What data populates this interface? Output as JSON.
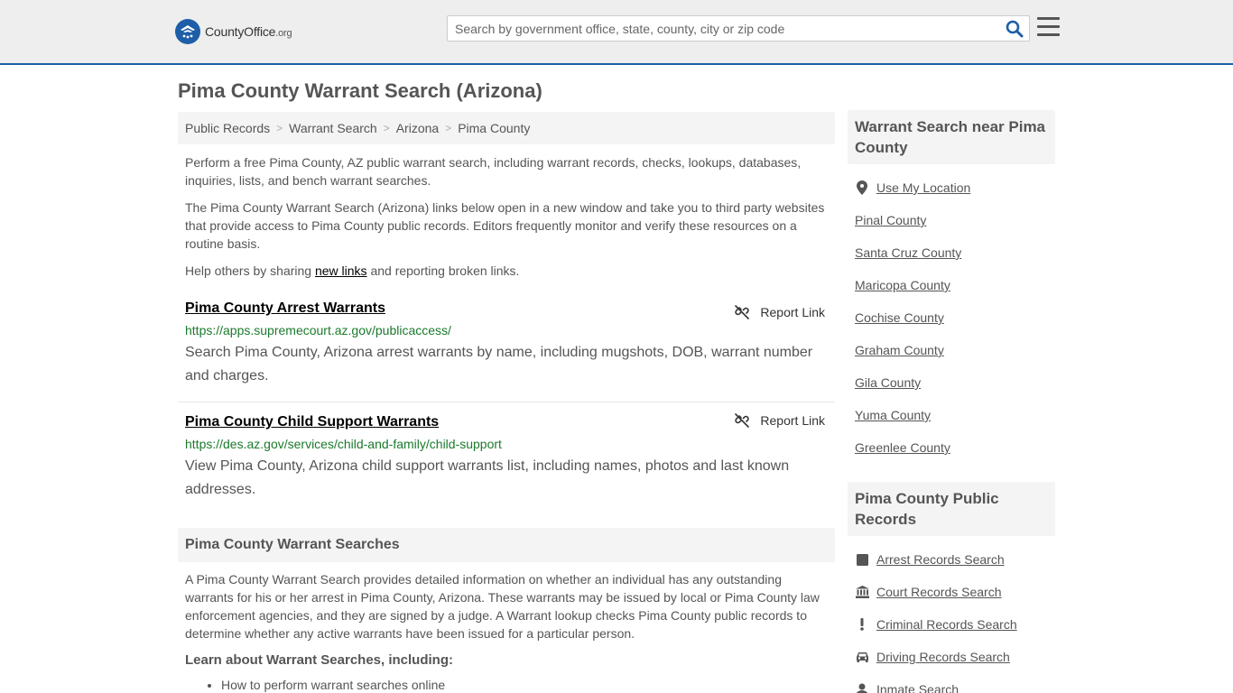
{
  "header": {
    "logo_text": "CountyOffice",
    "logo_suffix": ".org",
    "search_placeholder": "Search by government office, state, county, city or zip code"
  },
  "page_title": "Pima County Warrant Search (Arizona)",
  "breadcrumb": [
    "Public Records",
    "Warrant Search",
    "Arizona",
    "Pima County"
  ],
  "intro": {
    "p1": "Perform a free Pima County, AZ public warrant search, including warrant records, checks, lookups, databases, inquiries, lists, and bench warrant searches.",
    "p2": "The Pima County Warrant Search (Arizona) links below open in a new window and take you to third party websites that provide access to Pima County public records. Editors frequently monitor and verify these resources on a routine basis.",
    "p3_before": "Help others by sharing ",
    "p3_link": "new links",
    "p3_after": " and reporting broken links."
  },
  "links": [
    {
      "title": "Pima County Arrest Warrants",
      "url": "https://apps.supremecourt.az.gov/publicaccess/",
      "description": "Search Pima County, Arizona arrest warrants by name, including mugshots, DOB, warrant number and charges.",
      "report_label": "Report Link"
    },
    {
      "title": "Pima County Child Support Warrants",
      "url": "https://des.az.gov/services/child-and-family/child-support",
      "description": "View Pima County, Arizona child support warrants list, including names, photos and last known addresses.",
      "report_label": "Report Link"
    }
  ],
  "searches_section": {
    "title": "Pima County Warrant Searches",
    "body": "A Pima County Warrant Search provides detailed information on whether an individual has any outstanding warrants for his or her arrest in Pima County, Arizona. These warrants may be issued by local or Pima County law enforcement agencies, and they are signed by a judge. A Warrant lookup checks Pima County public records to determine whether any active warrants have been issued for a particular person.",
    "learn_head": "Learn about Warrant Searches, including:",
    "learn_items": [
      "How to perform warrant searches online"
    ]
  },
  "sidebar": {
    "near_title": "Warrant Search near Pima County",
    "near_items": [
      {
        "label": "Use My Location",
        "icon": "map-pin-icon"
      },
      {
        "label": "Pinal County"
      },
      {
        "label": "Santa Cruz County"
      },
      {
        "label": "Maricopa County"
      },
      {
        "label": "Cochise County"
      },
      {
        "label": "Graham County"
      },
      {
        "label": "Gila County"
      },
      {
        "label": "Yuma County"
      },
      {
        "label": "Greenlee County"
      }
    ],
    "records_title": "Pima County Public Records",
    "records_items": [
      {
        "label": "Arrest Records Search",
        "icon": "square-icon"
      },
      {
        "label": "Court Records Search",
        "icon": "courthouse-icon"
      },
      {
        "label": "Criminal Records Search",
        "icon": "exclamation-icon"
      },
      {
        "label": "Driving Records Search",
        "icon": "car-icon"
      },
      {
        "label": "Inmate Search",
        "icon": "inmate-icon"
      }
    ]
  },
  "colors": {
    "header_bg": "#eeeeee",
    "brand_blue": "#1e5ea8",
    "url_green": "#1b7a2c",
    "panel_bg": "#f4f4f4"
  }
}
